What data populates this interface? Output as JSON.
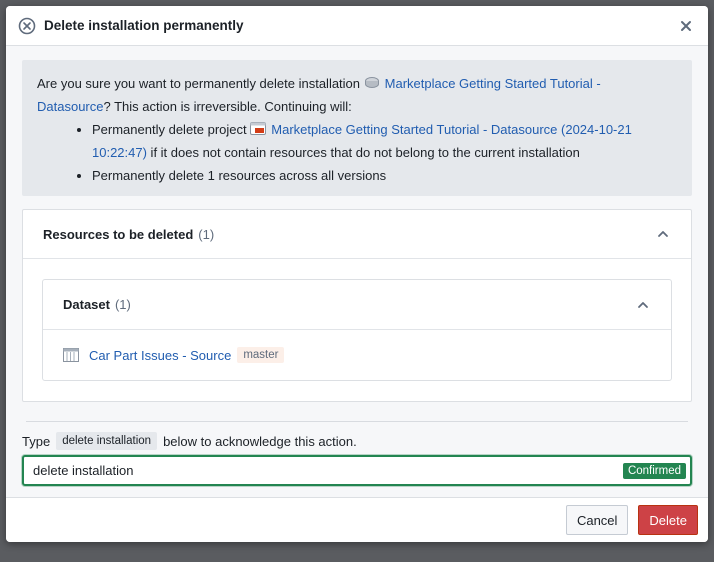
{
  "dialog": {
    "title": "Delete installation permanently",
    "title_icon": "circle-x-icon",
    "close_icon": "close-icon"
  },
  "callout": {
    "intro_prefix": "Are you sure you want to permanently delete installation ",
    "installation_link": "Marketplace Getting Started Tutorial - Datasource",
    "intro_suffix": "? This action is irreversible. Continuing will:",
    "bullets": {
      "project_prefix": "Permanently delete project ",
      "project_link": "Marketplace Getting Started Tutorial - Datasource (2024-10-21 10:22:47)",
      "project_suffix": " if it does not contain resources that do not belong to the current installation",
      "resources": "Permanently delete 1 resources across all versions"
    }
  },
  "resources_section": {
    "label": "Resources to be deleted",
    "count": "(1)",
    "groups": {
      "dataset": {
        "label": "Dataset",
        "count": "(1)",
        "items": {
          "0": {
            "name": "Car Part Issues - Source",
            "branch": "master"
          }
        }
      }
    }
  },
  "acknowledge": {
    "prefix": "Type",
    "phrase": "delete installation",
    "suffix": "below to acknowledge this action.",
    "input_value": "delete installation",
    "status": "Confirmed"
  },
  "footer": {
    "cancel_label": "Cancel",
    "delete_label": "Delete"
  },
  "colors": {
    "link": "#215db0",
    "confirmed": "#238551",
    "danger": "#cd4246"
  }
}
